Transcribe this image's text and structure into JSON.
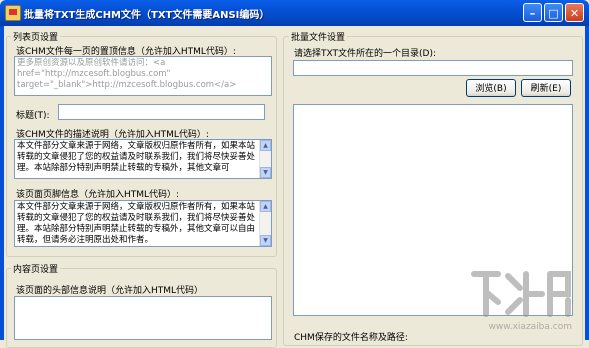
{
  "window": {
    "title": "批量将TXT生成CHM文件（TXT文件需要ANSI编码）",
    "minimize_glyph": "–",
    "maximize_glyph": "□",
    "close_glyph": "✕"
  },
  "list_page": {
    "legend": "列表页设置",
    "top_info_label": "该CHM文件每一页的置顶信息（允许加入HTML代码）:",
    "top_info_value": "更多原创资源以及原创软件请访问：<a href=\"http://mzcesoft.blogbus.com\" target=\"_blank\">http://mzcesoft.blogbus.com</a>",
    "title_label": "标题(T):",
    "title_value": "",
    "desc_label": "该CHM文件的描述说明（允许加入HTML代码）:",
    "desc_value": "本文件部分文章来源于网络，文章版权归原作者所有，如果本站转载的文章侵犯了您的权益请及时联系我们，我们将尽快妥善处理。本站除部分特别声明禁止转载的专稿外，其他文章可",
    "footer_label": "该页面页脚信息（允许加入HTML代码）:",
    "footer_value": "本文件部分文章来源于网络，文章版权归原作者所有，如果本站转载的文章侵犯了您的权益请及时联系我们，我们将尽快妥善处理。本站除部分特别声明禁止转载的专稿外，其他文章可以自由转载，但请务必注明原出处和作者。"
  },
  "content_page": {
    "legend": "内容页设置",
    "header_label": "该页面的头部信息说明（允许加入HTML代码）"
  },
  "batch": {
    "legend": "批量文件设置",
    "dir_label": "请选择TXT文件所在的一个目录(D):",
    "dir_value": "",
    "browse_label": "浏览(B)",
    "refresh_label": "刷新(E)",
    "save_path_label": "CHM保存的文件名称及路径:"
  },
  "watermark": {
    "text": "www.xiazaiba.com"
  }
}
